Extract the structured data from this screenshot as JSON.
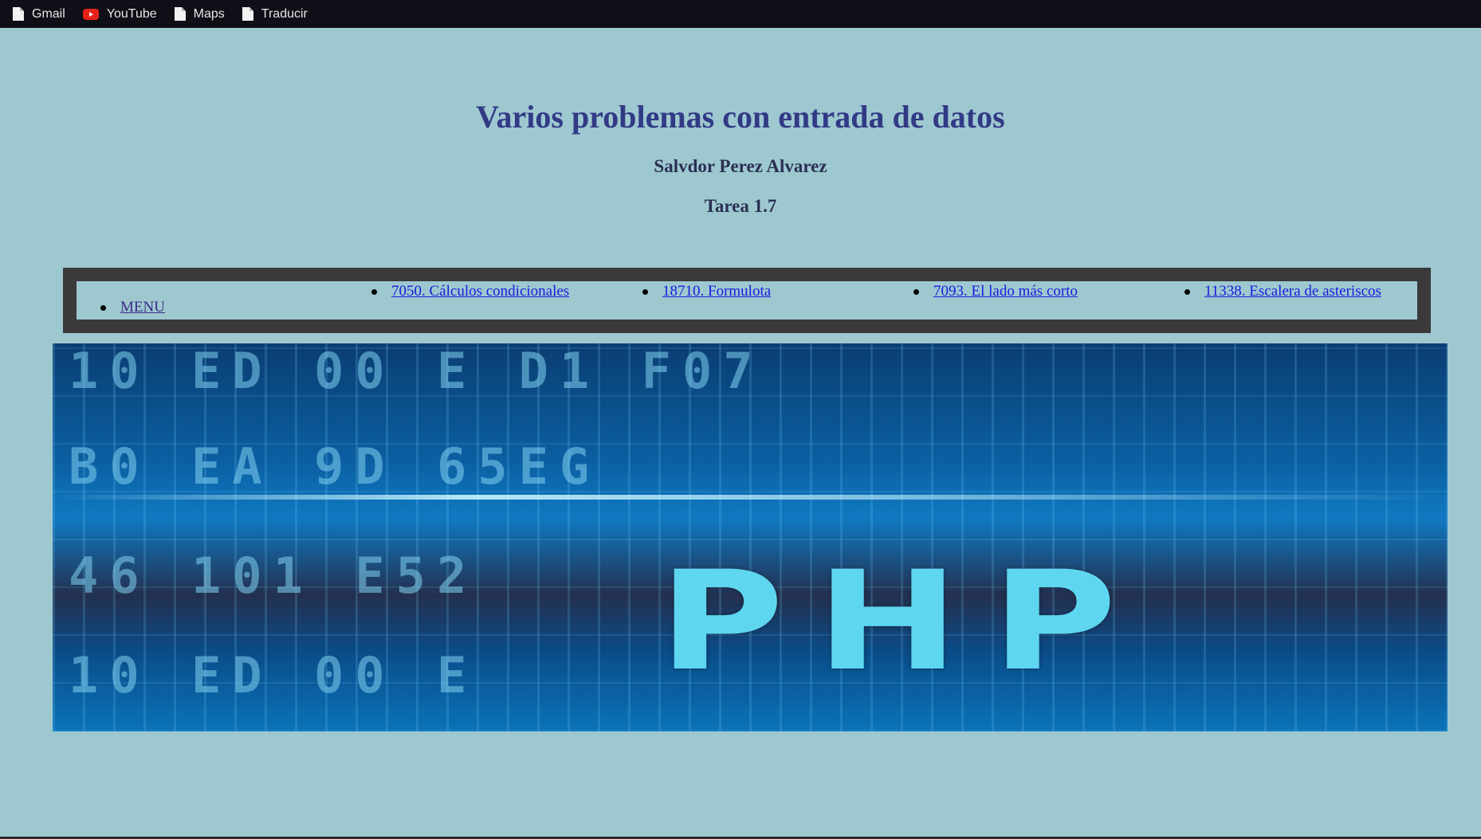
{
  "bookmarks": [
    {
      "label": "Gmail",
      "icon": "document-icon"
    },
    {
      "label": "YouTube",
      "icon": "youtube-icon"
    },
    {
      "label": "Maps",
      "icon": "document-icon"
    },
    {
      "label": "Traducir",
      "icon": "document-icon"
    }
  ],
  "header": {
    "title": "Varios problemas con entrada de datos",
    "author": "Salvdor Perez Alvarez",
    "task": "Tarea 1.7"
  },
  "nav": {
    "menu": "MENU",
    "items": [
      "7050. Cálculos condicionales",
      "18710. Formulota",
      "7093. El lado más corto",
      "11338. Escalera de asteriscos"
    ]
  },
  "banner": {
    "code_rows": [
      "10  ED   00  E   D1   F07",
      "B0  EA   9D   65EG",
      "46  101   E52",
      "10  ED   00  E"
    ],
    "php_text": "PHP",
    "colors": {
      "accent": "#5fd6f0",
      "dark": "#0a3d72"
    }
  },
  "colors": {
    "page_bg": "#9ec8d0",
    "title": "#323a86",
    "nav_border": "#3a3a3a",
    "link": "#1a1ae0"
  }
}
